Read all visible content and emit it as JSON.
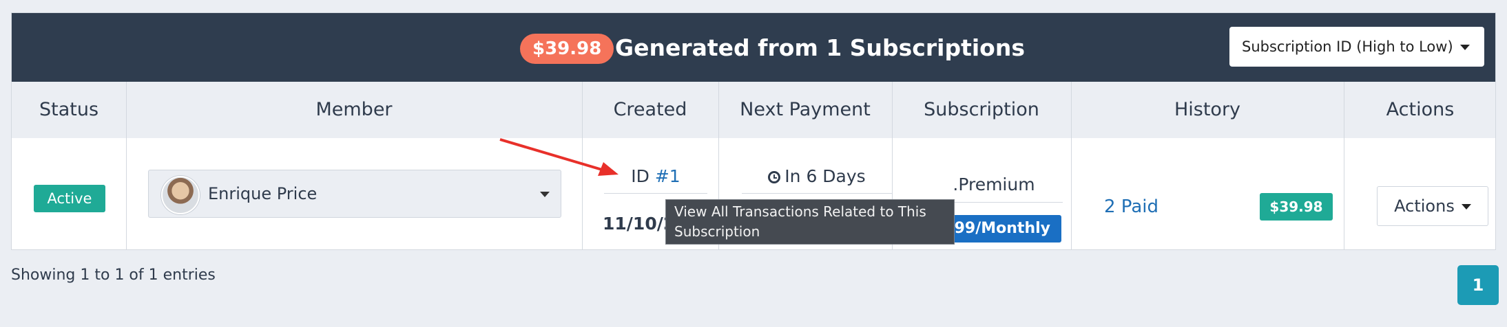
{
  "header": {
    "total_amount": "$39.98",
    "title": "Generated from 1 Subscriptions",
    "sort_select_value": "Subscription ID (High to Low)"
  },
  "table": {
    "columns": [
      "Status",
      "Member",
      "Created",
      "Next Payment",
      "Subscription",
      "History",
      "Actions"
    ],
    "row": {
      "status": "Active",
      "member_name": "Enrique Price",
      "created_id_prefix": "ID ",
      "created_id": "#1",
      "created_date": "11/10/2",
      "next_payment": "In 6 Days",
      "subscription_plan": ".Premium",
      "subscription_price": "99/Monthly",
      "history_paid": "2 Paid",
      "history_amount": "$39.98",
      "actions_label": "Actions"
    }
  },
  "tooltip": {
    "text": "View All Transactions Related to This Subscription"
  },
  "footer": {
    "entries_info": "Showing 1 to 1 of 1 entries",
    "current_page": "1"
  },
  "colors": {
    "header_bg": "#2f3d4f",
    "total_badge": "#f5735a",
    "active_badge": "#1faa96",
    "link": "#1f6fb5",
    "price_badge": "#1a6fc4",
    "pagination": "#1c9bb5",
    "annotation_arrow": "#e8302a"
  },
  "icons": {
    "next_payment": "clock-icon",
    "annotation": "arrow-icon"
  }
}
